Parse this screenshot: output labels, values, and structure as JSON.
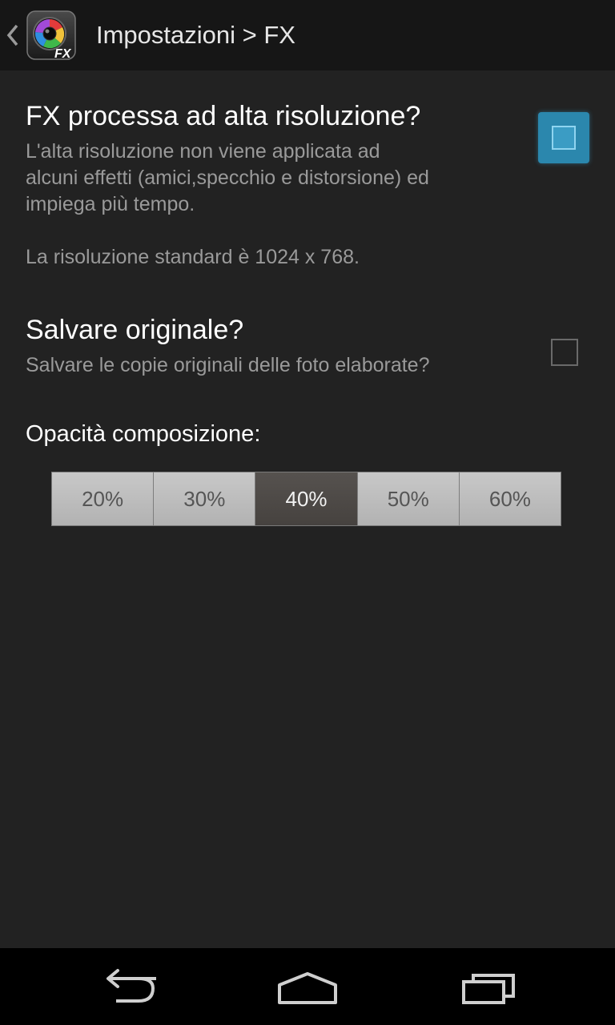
{
  "action_bar": {
    "title": "Impostazioni > FX",
    "app_icon_badge": "FX"
  },
  "preferences": {
    "high_res": {
      "title": "FX processa ad alta risoluzione?",
      "summary_lines": [
        "L'alta risoluzione non viene applicata ad",
        "alcuni effetti (amici,specchio e distorsione) ed",
        "impiega più tempo."
      ],
      "note": "La risoluzione standard è 1024 x 768.",
      "checked": true
    },
    "save_original": {
      "title": "Salvare originale?",
      "summary": "Salvare le copie originali delle foto elaborate?",
      "checked": false
    }
  },
  "opacity": {
    "label": "Opacità composizione:",
    "options": [
      "20%",
      "30%",
      "40%",
      "50%",
      "60%"
    ],
    "selected": "40%"
  },
  "colors": {
    "background": "#222222",
    "action_bar": "#161616",
    "accent": "#2b87ad",
    "segment_selected": "#4e4a47",
    "segment_normal": "#bdbdbd"
  },
  "nav_bar": {
    "icons": [
      "back-icon",
      "home-icon",
      "recent-apps-icon"
    ]
  }
}
